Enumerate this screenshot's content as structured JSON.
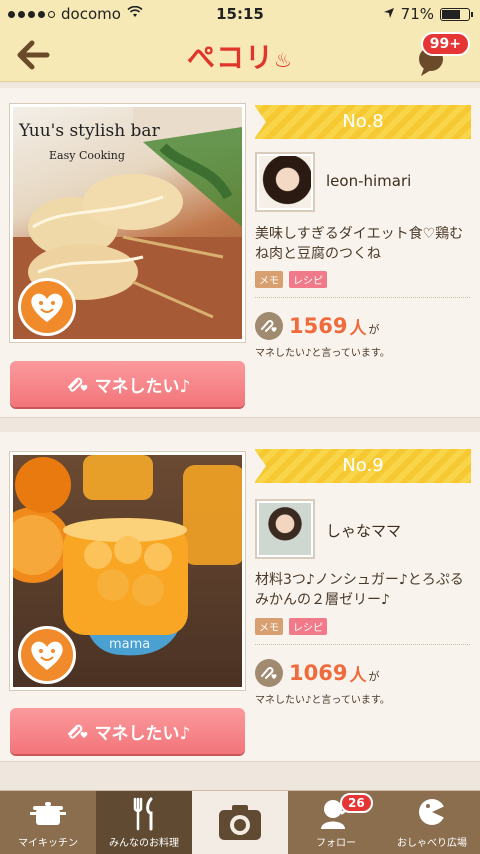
{
  "status_bar": {
    "carrier": "docomo",
    "time": "15:15",
    "battery": "71%",
    "battery_level": 0.71
  },
  "header": {
    "logo_text": "ぺコリ",
    "notification_count": "99+"
  },
  "cards": [
    {
      "rank": "No.8",
      "photo_overlay_title": "Yuu's stylish bar",
      "photo_overlay_subtitle": "Easy Cooking",
      "username": "leon-himari",
      "title": "美味しすぎるダイエット食♡鶏むね肉と豆腐のつくね",
      "tags": [
        "メモ",
        "レシピ"
      ],
      "count": "1569",
      "count_unit": "人",
      "count_suffix": "が",
      "count_note": "マネしたい♪と言っています。",
      "button_label": "マネしたい♪"
    },
    {
      "rank": "No.9",
      "photo_overlay_title": "mama",
      "username": "しゃなママ",
      "title": "材料3つ♪ノンシュガー♪とろぷるみかんの２層ゼリー♪",
      "tags": [
        "メモ",
        "レシピ"
      ],
      "count": "1069",
      "count_unit": "人",
      "count_suffix": "が",
      "count_note": "マネしたい♪と言っています。",
      "button_label": "マネしたい♪"
    }
  ],
  "tabbar": {
    "items": [
      {
        "label": "マイキッチン",
        "icon": "pot-icon"
      },
      {
        "label": "みんなのお料理",
        "icon": "utensils-icon"
      },
      {
        "label": "",
        "icon": "camera-icon"
      },
      {
        "label": "フォロー",
        "icon": "follow-icon",
        "badge": "26"
      },
      {
        "label": "おしゃべり広場",
        "icon": "chat-icon"
      }
    ]
  },
  "colors": {
    "header_bg": "#f7e9b6",
    "accent": "#ef6a3c",
    "button_pink": "#f2757a",
    "tab_brown": "#8b6e4e"
  }
}
